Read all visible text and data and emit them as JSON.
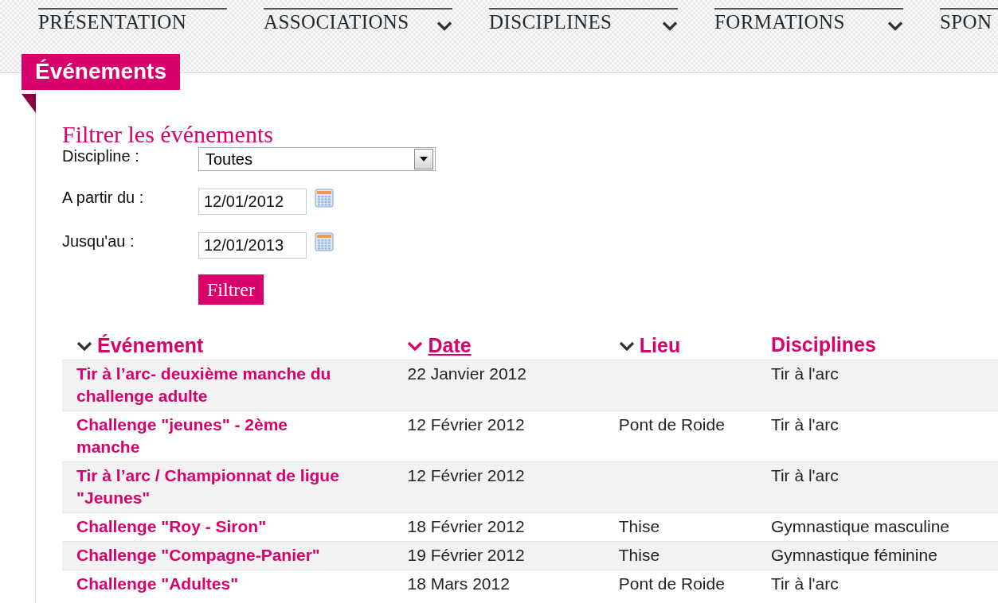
{
  "nav": [
    {
      "label": "PRÉSENTATION",
      "dropdown": false
    },
    {
      "label": "ASSOCIATIONS",
      "dropdown": true
    },
    {
      "label": "DISCIPLINES",
      "dropdown": true
    },
    {
      "label": "FORMATIONS",
      "dropdown": true
    },
    {
      "label": "SPON"
    }
  ],
  "page_tab": "Événements",
  "filter": {
    "title": "Filtrer les événements",
    "discipline": {
      "label": "Discipline :",
      "value": "Toutes"
    },
    "from": {
      "label": "A partir du :",
      "value": "12/01/2012"
    },
    "to": {
      "label": "Jusqu'au :",
      "value": "12/01/2013"
    },
    "button": "Filtrer"
  },
  "table": {
    "columns": [
      {
        "label": "Événement",
        "kind": "sortable",
        "selected": false
      },
      {
        "label": "Date",
        "kind": "sortable",
        "selected": true
      },
      {
        "label": "Lieu",
        "kind": "sortable",
        "selected": false
      },
      {
        "label": "Disciplines",
        "kind": "plain",
        "selected": false
      }
    ],
    "rows": [
      {
        "event": "Tir à l’arc- deuxième manche du challenge adulte",
        "date": "22 Janvier 2012",
        "place": "",
        "discipline": "Tir à l'arc"
      },
      {
        "event": "Challenge \"jeunes\" - 2ème manche",
        "date": "12 Février 2012",
        "place": "Pont de Roide",
        "discipline": "Tir à l'arc"
      },
      {
        "event": "Tir à l’arc / Championnat de ligue \"Jeunes\"",
        "date": "12 Février 2012",
        "place": "",
        "discipline": "Tir à l'arc"
      },
      {
        "event": "Challenge \"Roy - Siron\"",
        "date": "18 Février 2012",
        "place": "Thise",
        "discipline": "Gymnastique masculine"
      },
      {
        "event": "Challenge \"Compagne-Panier\"",
        "date": "19 Février 2012",
        "place": "Thise",
        "discipline": "Gymnastique féminine"
      },
      {
        "event": "Challenge \"Adultes\"",
        "date": "18 Mars 2012",
        "place": "Pont de Roide",
        "discipline": "Tir à l'arc"
      }
    ]
  }
}
